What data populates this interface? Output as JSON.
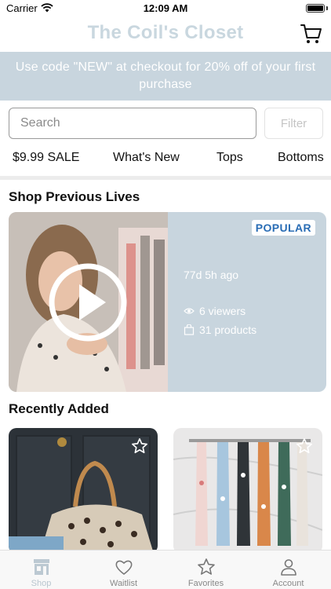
{
  "status_bar": {
    "carrier": "Carrier",
    "time": "12:09 AM"
  },
  "header": {
    "title": "The Coil's Closet",
    "cart_icon": "cart-icon"
  },
  "promo": {
    "text": "Use code \"NEW\" at checkout for 20% off of your first purchase"
  },
  "search": {
    "placeholder": "Search",
    "value": "",
    "filter_label": "Filter"
  },
  "categories": [
    "$9.99 SALE",
    "What's New",
    "Tops",
    "Bottoms"
  ],
  "sections": {
    "previous_lives": "Shop Previous Lives",
    "recently_added": "Recently Added"
  },
  "live": {
    "badge": "POPULAR",
    "time_ago": "77d 5h ago",
    "viewers": "6 viewers",
    "products": "31 products",
    "thumbnail_icon": "play-icon"
  },
  "products": [
    {
      "name": "Leopard print tote bag",
      "favorite_icon": "star-icon"
    },
    {
      "name": "Printed hair scarves",
      "favorite_icon": "star-icon"
    }
  ],
  "tabs": [
    {
      "label": "Shop",
      "icon": "shop-icon",
      "active": true
    },
    {
      "label": "Waitlist",
      "icon": "heart-icon",
      "active": false
    },
    {
      "label": "Favorites",
      "icon": "star-icon",
      "active": false
    },
    {
      "label": "Account",
      "icon": "person-icon",
      "active": false
    }
  ],
  "colors": {
    "accent": "#c8d5de",
    "title": "#c9d7df",
    "badge_text": "#2a6db5"
  }
}
